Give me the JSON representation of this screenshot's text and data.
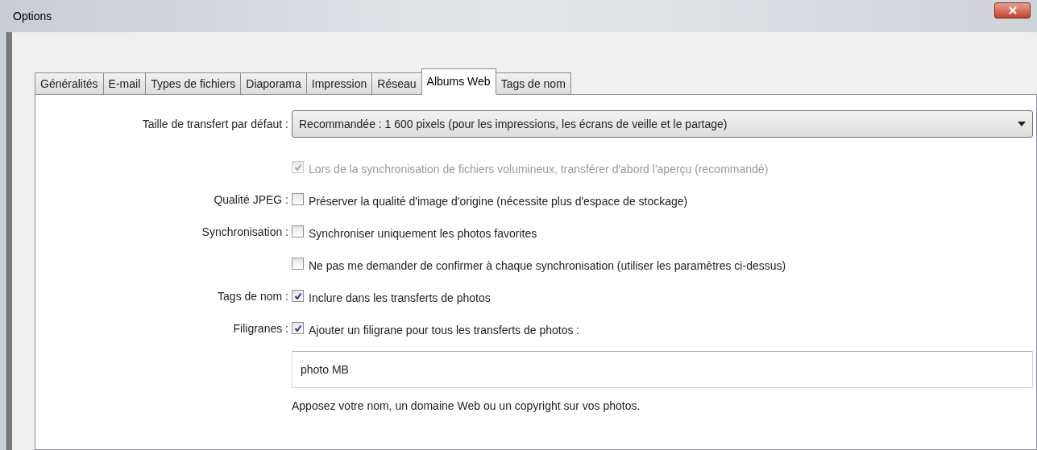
{
  "window": {
    "title": "Options"
  },
  "tabs": [
    {
      "label": "Généralités",
      "selected": false
    },
    {
      "label": "E-mail",
      "selected": false
    },
    {
      "label": "Types de fichiers",
      "selected": false
    },
    {
      "label": "Diaporama",
      "selected": false
    },
    {
      "label": "Impression",
      "selected": false
    },
    {
      "label": "Réseau",
      "selected": false
    },
    {
      "label": "Albums Web",
      "selected": true
    },
    {
      "label": "Tags de nom",
      "selected": false
    }
  ],
  "transfer_size": {
    "label": "Taille de transfert par défaut :",
    "value": "Recommandée : 1 600 pixels (pour les impressions, les écrans de veille et le partage)"
  },
  "rows": [
    {
      "kind": "checkbox",
      "text": "Lors de la synchronisation de fichiers volumineux, transférer d'abord l'aperçu (recommandé)",
      "checked": true,
      "disabled": true
    },
    {
      "kind": "checkbox",
      "label": "Qualité JPEG :",
      "text": "Préserver la qualité d'image d'origine (nécessite plus d'espace de stockage)",
      "checked": false,
      "disabled": false
    },
    {
      "kind": "checkbox",
      "label": "Synchronisation :",
      "text": "Synchroniser uniquement les photos favorites",
      "checked": false,
      "disabled": false
    },
    {
      "kind": "checkbox",
      "text": "Ne pas me demander de confirmer à chaque synchronisation (utiliser les paramètres ci-dessus)",
      "checked": false,
      "disabled": false
    },
    {
      "kind": "checkbox",
      "label": "Tags de nom :",
      "text": "Inclure dans les transferts de photos",
      "checked": true,
      "disabled": false
    },
    {
      "kind": "checkbox",
      "label": "Filigranes :",
      "text": "Ajouter un filigrane pour tous les transferts de photos :",
      "checked": true,
      "disabled": false
    },
    {
      "kind": "field",
      "value": "photo MB"
    },
    {
      "kind": "hint",
      "text": "Apposez votre nom, un domaine Web ou un copyright sur vos photos."
    }
  ]
}
